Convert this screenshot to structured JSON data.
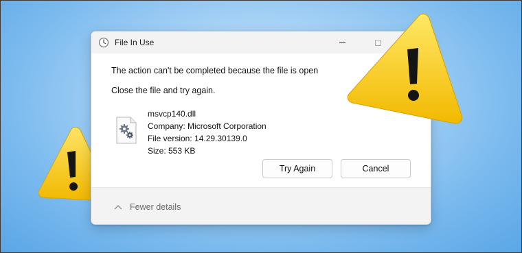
{
  "dialog": {
    "title": "File In Use",
    "title_icon": "clock-icon",
    "message": "The action can't be completed because the file is open",
    "instruction": "Close the file and try again.",
    "file": {
      "icon": "gear-file-icon",
      "name": "msvcp140.dll",
      "company": "Company: Microsoft Corporation",
      "version": "File version: 14.29.30139.0",
      "size": "Size: 553 KB"
    },
    "buttons": {
      "try_again": "Try Again",
      "cancel": "Cancel"
    },
    "footer": {
      "details_toggle": "Fewer details",
      "toggle_icon": "chevron-up-icon"
    },
    "window_controls": [
      "minimize-icon",
      "maximize-icon"
    ]
  },
  "decorations": {
    "warning_icon": "warning-triangle-icon",
    "colors": {
      "background": "#79b9ee",
      "warning_fill": "#f4c20d",
      "warning_glyph": "#111111"
    }
  }
}
